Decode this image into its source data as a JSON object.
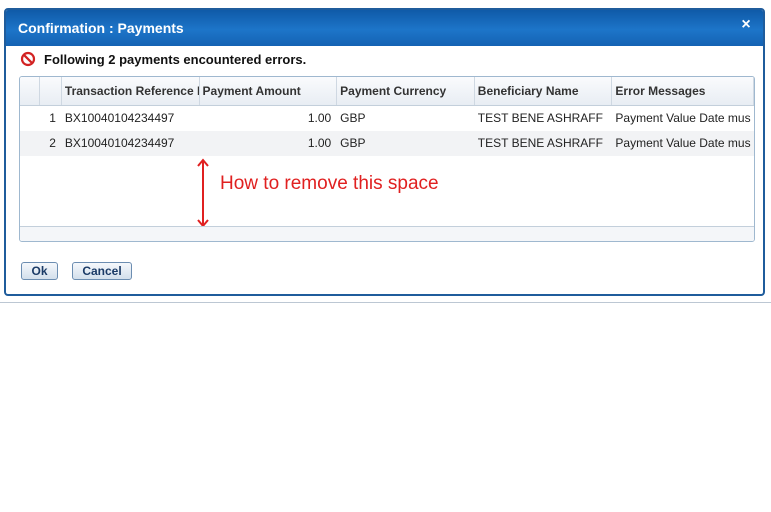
{
  "dialog": {
    "title": "Confirmation : Payments",
    "close_glyph": "×",
    "error_icon": "prohibited-icon",
    "error_color": "#d22323",
    "message": "Following 2 payments encountered errors."
  },
  "grid": {
    "columns": [
      "Transaction Reference I",
      "Payment Amount",
      "Payment Currency",
      "Beneficiary Name",
      "Error Messages"
    ],
    "rows": [
      {
        "num": "1",
        "ref": "BX10040104234497",
        "amount": "1.00",
        "currency": "GBP",
        "beneficiary": "TEST BENE ASHRAFF",
        "error": "Payment Value Date mus"
      },
      {
        "num": "2",
        "ref": "BX10040104234497",
        "amount": "1.00",
        "currency": "GBP",
        "beneficiary": "TEST BENE ASHRAFF",
        "error": "Payment Value Date mus"
      }
    ]
  },
  "annotation": {
    "text": "How to remove this space",
    "color": "#e02020"
  },
  "buttons": {
    "ok": "Ok",
    "cancel": "Cancel"
  },
  "colors": {
    "titlebar": "#1d75c9",
    "border": "#1f5c9c"
  }
}
